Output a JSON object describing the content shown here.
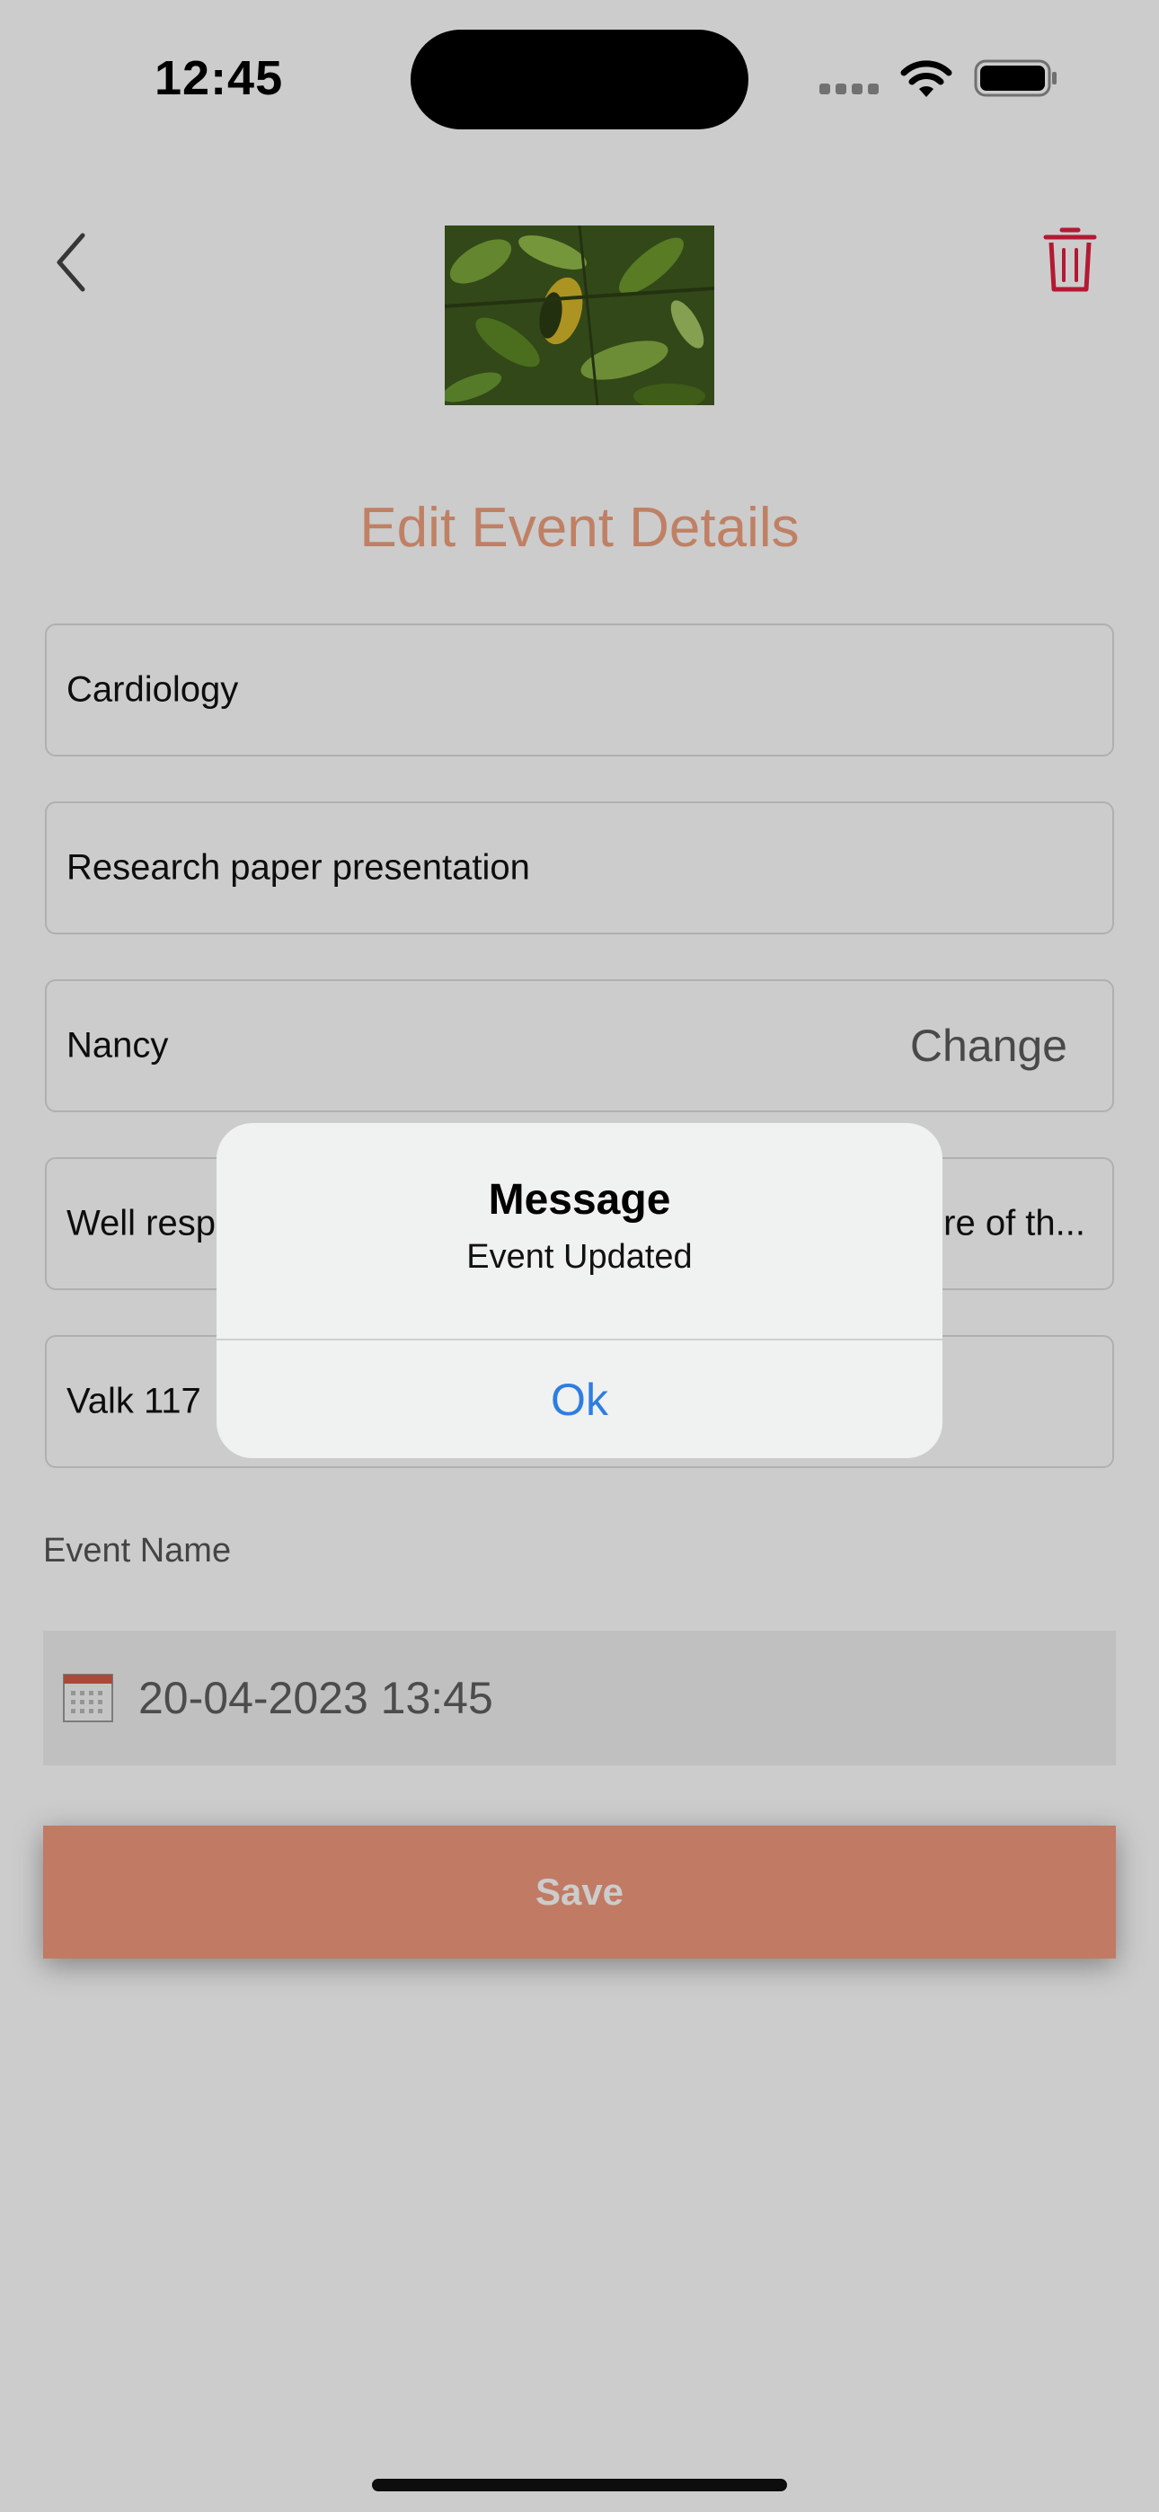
{
  "status_bar": {
    "time": "12:45"
  },
  "header": {
    "title": "Edit Event Details"
  },
  "fields": {
    "specialty": "Cardiology",
    "event_type": "Research paper presentation",
    "person": "Nancy",
    "person_action": "Change",
    "description_left": "Well resp",
    "description_right": "re of th...",
    "location": "Valk 117"
  },
  "event_name_label": "Event Name",
  "date": {
    "value": "20-04-2023 13:45"
  },
  "save_label": "Save",
  "alert": {
    "title": "Message",
    "message": "Event Updated",
    "ok_label": "Ok"
  },
  "colors": {
    "accent": "#f2997c",
    "title": "#f0a07e",
    "trash": "#e0213f",
    "link": "#2f7de1"
  }
}
